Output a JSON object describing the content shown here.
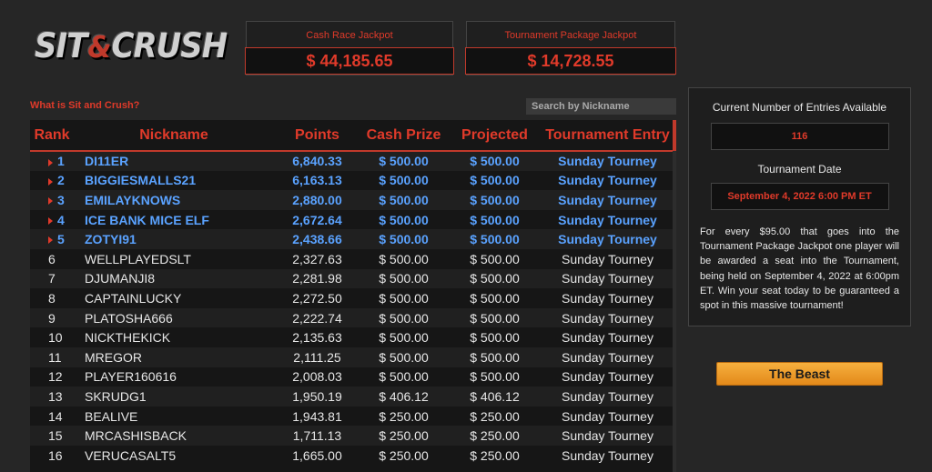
{
  "logo": {
    "part1": "SIT",
    "amp": "&",
    "part2": "CRUSH"
  },
  "jackpots": {
    "cash_race": {
      "title": "Cash Race Jackpot",
      "value": "$ 44,185.65"
    },
    "tournament": {
      "title": "Tournament Package Jackpot",
      "value": "$ 14,728.55"
    }
  },
  "what_link": "What is Sit and Crush?",
  "search": {
    "placeholder": "Search by Nickname"
  },
  "table": {
    "headers": {
      "rank": "Rank",
      "nickname": "Nickname",
      "points": "Points",
      "cash_prize": "Cash Prize",
      "projected": "Projected",
      "tournament_entry": "Tournament Entry"
    },
    "rows": [
      {
        "rank": "1",
        "nick": "DI11ER",
        "points": "6,840.33",
        "cash": "$ 500.00",
        "proj": "$ 500.00",
        "tour": "Sunday Tourney"
      },
      {
        "rank": "2",
        "nick": "BIGGIESMALLS21",
        "points": "6,163.13",
        "cash": "$ 500.00",
        "proj": "$ 500.00",
        "tour": "Sunday Tourney"
      },
      {
        "rank": "3",
        "nick": "EMILAYKNOWS",
        "points": "2,880.00",
        "cash": "$ 500.00",
        "proj": "$ 500.00",
        "tour": "Sunday Tourney"
      },
      {
        "rank": "4",
        "nick": "ICE BANK MICE ELF",
        "points": "2,672.64",
        "cash": "$ 500.00",
        "proj": "$ 500.00",
        "tour": "Sunday Tourney"
      },
      {
        "rank": "5",
        "nick": "ZOTYI91",
        "points": "2,438.66",
        "cash": "$ 500.00",
        "proj": "$ 500.00",
        "tour": "Sunday Tourney"
      },
      {
        "rank": "6",
        "nick": "WELLPLAYEDSLT",
        "points": "2,327.63",
        "cash": "$ 500.00",
        "proj": "$ 500.00",
        "tour": "Sunday Tourney"
      },
      {
        "rank": "7",
        "nick": "DJUMANJI8",
        "points": "2,281.98",
        "cash": "$ 500.00",
        "proj": "$ 500.00",
        "tour": "Sunday Tourney"
      },
      {
        "rank": "8",
        "nick": "CAPTAINLUCKY",
        "points": "2,272.50",
        "cash": "$ 500.00",
        "proj": "$ 500.00",
        "tour": "Sunday Tourney"
      },
      {
        "rank": "9",
        "nick": "PLATOSHA666",
        "points": "2,222.74",
        "cash": "$ 500.00",
        "proj": "$ 500.00",
        "tour": "Sunday Tourney"
      },
      {
        "rank": "10",
        "nick": "NICKTHEKICK",
        "points": "2,135.63",
        "cash": "$ 500.00",
        "proj": "$ 500.00",
        "tour": "Sunday Tourney"
      },
      {
        "rank": "11",
        "nick": "MREGOR",
        "points": "2,111.25",
        "cash": "$ 500.00",
        "proj": "$ 500.00",
        "tour": "Sunday Tourney"
      },
      {
        "rank": "12",
        "nick": "PLAYER160616",
        "points": "2,008.03",
        "cash": "$ 500.00",
        "proj": "$ 500.00",
        "tour": "Sunday Tourney"
      },
      {
        "rank": "13",
        "nick": "SKRUDG1",
        "points": "1,950.19",
        "cash": "$ 406.12",
        "proj": "$ 406.12",
        "tour": "Sunday Tourney"
      },
      {
        "rank": "14",
        "nick": "BEALIVE",
        "points": "1,943.81",
        "cash": "$ 250.00",
        "proj": "$ 250.00",
        "tour": "Sunday Tourney"
      },
      {
        "rank": "15",
        "nick": "MRCASHISBACK",
        "points": "1,711.13",
        "cash": "$ 250.00",
        "proj": "$ 250.00",
        "tour": "Sunday Tourney"
      },
      {
        "rank": "16",
        "nick": "VERUCASALT5",
        "points": "1,665.00",
        "cash": "$ 250.00",
        "proj": "$ 250.00",
        "tour": "Sunday Tourney"
      }
    ]
  },
  "panel": {
    "entries_label": "Current Number of Entries Available",
    "entries_value": "116",
    "date_label": "Tournament Date",
    "date_value": "September 4, 2022 6:00 PM ET",
    "description": "For every $95.00 that goes into the Tournament Package Jackpot one player will be awarded a seat into the Tournament, being held on September 4, 2022 at 6:00pm ET. Win your seat today to be guaranteed a spot in this massive tournament!"
  },
  "beast_button": "The Beast",
  "colors": {
    "accent": "#e03a2a",
    "highlight": "#5aa2ff",
    "button": "#f0a030"
  }
}
